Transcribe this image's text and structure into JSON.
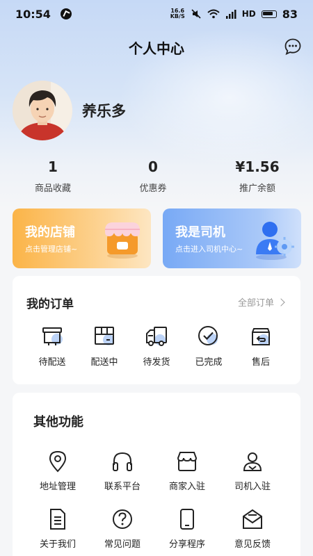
{
  "status_bar": {
    "time": "10:54",
    "net_speed_value": "16.6",
    "net_speed_unit": "KB/S",
    "battery_level": "83",
    "network": "HD"
  },
  "header": {
    "title": "个人中心"
  },
  "profile": {
    "username": "养乐多"
  },
  "stats": [
    {
      "value": "1",
      "label": "商品收藏"
    },
    {
      "value": "0",
      "label": "优惠券"
    },
    {
      "value": "¥1.56",
      "label": "推广余额"
    }
  ],
  "cards": {
    "shop": {
      "title": "我的店铺",
      "subtitle": "点击管理店铺~"
    },
    "driver": {
      "title": "我是司机",
      "subtitle": "点击进入司机中心~"
    }
  },
  "orders": {
    "title": "我的订单",
    "all_label": "全部订单",
    "items": [
      {
        "label": "待配送",
        "icon": "pending-delivery-icon"
      },
      {
        "label": "配送中",
        "icon": "in-delivery-icon"
      },
      {
        "label": "待发货",
        "icon": "truck-icon"
      },
      {
        "label": "已完成",
        "icon": "check-icon"
      },
      {
        "label": "售后",
        "icon": "after-sale-icon"
      }
    ]
  },
  "other": {
    "title": "其他功能",
    "items": [
      {
        "label": "地址管理",
        "icon": "location-icon"
      },
      {
        "label": "联系平台",
        "icon": "headset-icon"
      },
      {
        "label": "商家入驻",
        "icon": "store-icon"
      },
      {
        "label": "司机入驻",
        "icon": "driver-icon"
      },
      {
        "label": "关于我们",
        "icon": "document-icon"
      },
      {
        "label": "常见问题",
        "icon": "question-icon"
      },
      {
        "label": "分享程序",
        "icon": "phone-icon"
      },
      {
        "label": "意见反馈",
        "icon": "mail-icon"
      }
    ]
  },
  "colors": {
    "accent_blue": "#5b8ef0",
    "shop_orange": "#fbb448",
    "driver_blue": "#78a9f5"
  }
}
